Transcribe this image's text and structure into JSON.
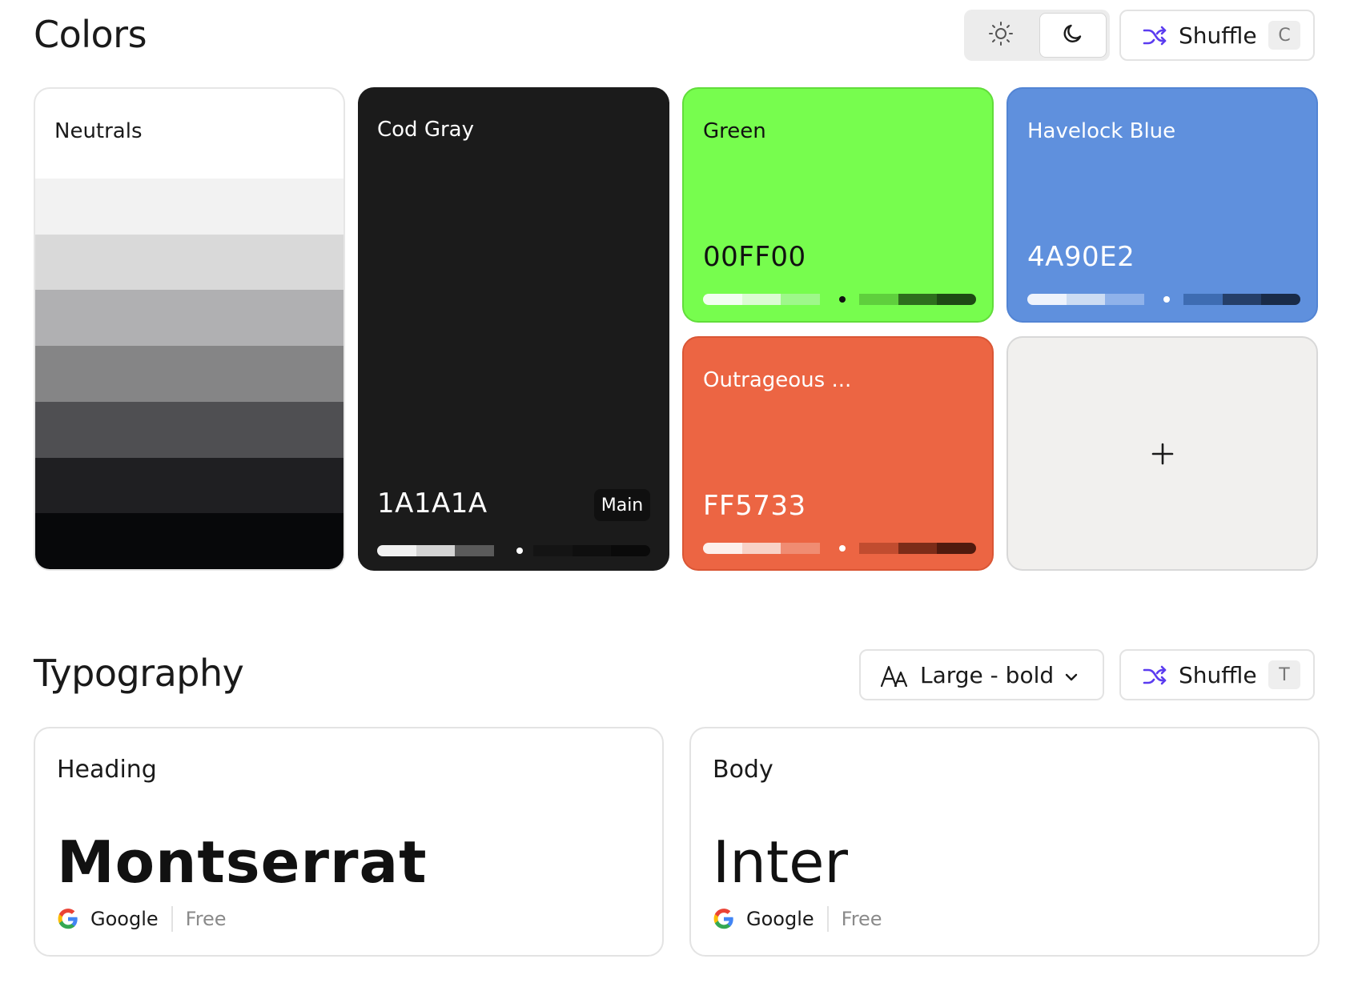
{
  "colors_section": {
    "title": "Colors",
    "theme_toggle": {
      "light_icon": "sun-icon",
      "dark_icon": "moon-icon",
      "selected": "dark"
    },
    "shuffle": {
      "label": "Shuffle",
      "shortcut": "C",
      "icon": "shuffle-icon"
    },
    "cards": {
      "neutrals": {
        "title": "Neutrals",
        "shades": [
          "#f2f2f2",
          "#d9d9d9",
          "#b0b0b2",
          "#858586",
          "#4f4f52",
          "#1f1f22",
          "#07080a"
        ]
      },
      "codgray": {
        "title": "Cod Gray",
        "hex": "1A1A1A",
        "badge": "Main",
        "bg": "#1b1b1b",
        "scale": [
          "#f1f1f1",
          "#d3d3d3",
          "#5a5a5a",
          "#1b1b1b",
          "#141414",
          "#0f0f0f",
          "#0a0a0a"
        ]
      },
      "green": {
        "title": "Green",
        "hex": "00FF00",
        "bg": "#77fd4e",
        "scale": [
          "#f2fff0",
          "#dbfcd2",
          "#9ef88a",
          "#77fd4e",
          "#5fcf3d",
          "#2e6e1d",
          "#1e4a14"
        ]
      },
      "blue": {
        "title": "Havelock Blue",
        "hex": "4A90E2",
        "bg": "#5f90dd",
        "scale": [
          "#eef3fc",
          "#ccdcf3",
          "#8fb2ea",
          "#5f90dd",
          "#3e6cb2",
          "#253f69",
          "#192b48"
        ]
      },
      "orange": {
        "title": "Outrageous ...",
        "hex": "FF5733",
        "bg": "#ec6543",
        "scale": [
          "#fdf0ec",
          "#f8d2c7",
          "#f08c72",
          "#ec6543",
          "#c14c2f",
          "#7c2c18",
          "#501a0e"
        ]
      },
      "add": {
        "icon": "plus-icon"
      }
    }
  },
  "typography_section": {
    "title": "Typography",
    "size_select": {
      "label": "Large - bold",
      "icon": "font-size-icon"
    },
    "shuffle": {
      "label": "Shuffle",
      "shortcut": "T",
      "icon": "shuffle-icon"
    },
    "heading": {
      "role": "Heading",
      "font": "Montserrat",
      "provider": "Google",
      "price": "Free"
    },
    "body": {
      "role": "Body",
      "font": "Inter",
      "provider": "Google",
      "price": "Free"
    }
  }
}
